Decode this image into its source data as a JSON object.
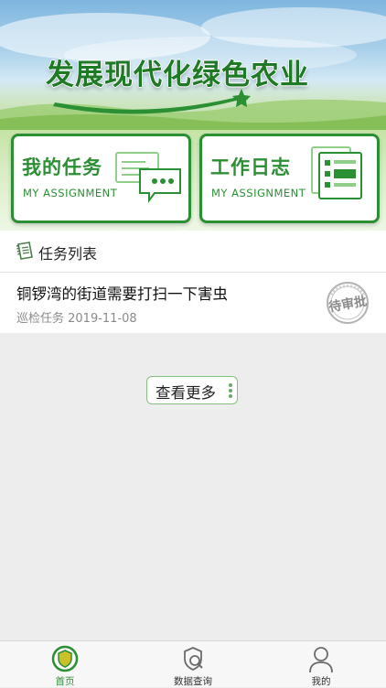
{
  "banner": {
    "slogan": "发展现代化绿色农业"
  },
  "cards": [
    {
      "title": "我的任务",
      "subtitle": "MY ASSIGNMENT"
    },
    {
      "title": "工作日志",
      "subtitle": "MY ASSIGNMENT"
    }
  ],
  "tasks": {
    "header": "任务列表",
    "items": [
      {
        "title": "铜锣湾的街道需要打扫一下害虫",
        "meta": "巡检任务 2019-11-08",
        "status": "待审批"
      }
    ],
    "more_label": "查看更多"
  },
  "tabbar": {
    "items": [
      {
        "label": "首页",
        "icon": "home-shield-icon",
        "active": true
      },
      {
        "label": "数据查询",
        "icon": "data-search-icon",
        "active": false
      },
      {
        "label": "我的",
        "icon": "user-icon",
        "active": false
      }
    ]
  },
  "colors": {
    "brand_green": "#2b8f33",
    "background": "#ededed"
  }
}
